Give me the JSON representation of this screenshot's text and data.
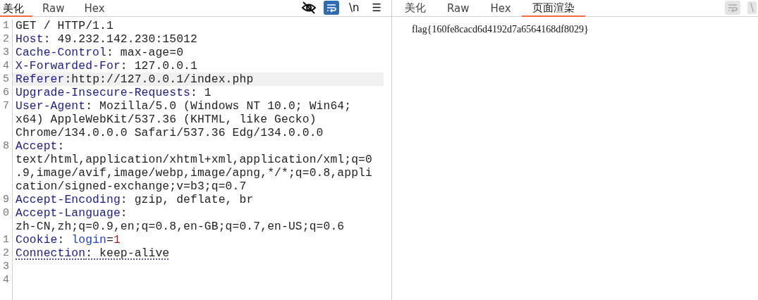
{
  "request_pane": {
    "tabs": [
      {
        "label": "美化",
        "selected": true
      },
      {
        "label": "Raw",
        "selected": false
      },
      {
        "label": "Hex",
        "selected": false
      }
    ],
    "toolbar": {
      "wrap_on": true,
      "newline_label": "\\n",
      "menu_label": "☰"
    },
    "lines": [
      {
        "number": "1",
        "highlighted": false,
        "underlined": false,
        "rows": [
          [
            {
              "kind": "plain",
              "text": "GET / HTTP/1.1"
            }
          ]
        ]
      },
      {
        "number": "2",
        "highlighted": false,
        "underlined": false,
        "rows": [
          [
            {
              "kind": "key",
              "text": "Host"
            },
            {
              "kind": "plain",
              "text": ": 49.232.142.230:15012"
            }
          ]
        ]
      },
      {
        "number": "3",
        "highlighted": false,
        "underlined": false,
        "rows": [
          [
            {
              "kind": "key",
              "text": "Cache-Control"
            },
            {
              "kind": "plain",
              "text": ": max-age=0"
            }
          ]
        ]
      },
      {
        "number": "4",
        "highlighted": false,
        "underlined": false,
        "rows": [
          [
            {
              "kind": "key",
              "text": "X-Forwarded-For"
            },
            {
              "kind": "plain",
              "text": ": 127.0.0.1"
            }
          ]
        ]
      },
      {
        "number": "5",
        "highlighted": true,
        "underlined": false,
        "rows": [
          [
            {
              "kind": "key",
              "text": "Referer"
            },
            {
              "kind": "plain",
              "text": ":http://127.0.0.1/index.php"
            }
          ]
        ]
      },
      {
        "number": "6",
        "highlighted": false,
        "underlined": false,
        "rows": [
          [
            {
              "kind": "key",
              "text": "Upgrade-Insecure-Requests"
            },
            {
              "kind": "plain",
              "text": ": 1"
            }
          ]
        ]
      },
      {
        "number": "7",
        "highlighted": false,
        "underlined": false,
        "rows": [
          [
            {
              "kind": "key",
              "text": "User-Agent"
            },
            {
              "kind": "plain",
              "text": ": Mozilla/5.0 (Windows NT 10.0; Win64;"
            }
          ],
          [
            {
              "kind": "plain",
              "text": "x64) AppleWebKit/537.36 (KHTML, like Gecko)"
            }
          ],
          [
            {
              "kind": "plain",
              "text": "Chrome/134.0.0.0 Safari/537.36 Edg/134.0.0.0"
            }
          ]
        ]
      },
      {
        "number": "8",
        "highlighted": false,
        "underlined": false,
        "rows": [
          [
            {
              "kind": "key",
              "text": "Accept"
            },
            {
              "kind": "plain",
              "text": ":"
            }
          ],
          [
            {
              "kind": "plain",
              "text": "text/html,application/xhtml+xml,application/xml;q=0"
            }
          ],
          [
            {
              "kind": "plain",
              "text": ".9,image/avif,image/webp,image/apng,*/*;q=0.8,appli"
            }
          ],
          [
            {
              "kind": "plain",
              "text": "cation/signed-exchange;v=b3;q=0.7"
            }
          ]
        ]
      },
      {
        "number": "9",
        "highlighted": false,
        "underlined": false,
        "rows": [
          [
            {
              "kind": "key",
              "text": "Accept-Encoding"
            },
            {
              "kind": "plain",
              "text": ": gzip, deflate, br"
            }
          ]
        ]
      },
      {
        "number": "0",
        "highlighted": false,
        "underlined": false,
        "rows": [
          [
            {
              "kind": "key",
              "text": "Accept-Language"
            },
            {
              "kind": "plain",
              "text": ":"
            }
          ],
          [
            {
              "kind": "plain",
              "text": "zh-CN,zh;q=0.9,en;q=0.8,en-GB;q=0.7,en-US;q=0.6"
            }
          ]
        ]
      },
      {
        "number": "1",
        "highlighted": false,
        "underlined": false,
        "rows": [
          [
            {
              "kind": "key",
              "text": "Cookie"
            },
            {
              "kind": "plain",
              "text": ": "
            },
            {
              "kind": "name",
              "text": "login"
            },
            {
              "kind": "plain",
              "text": "="
            },
            {
              "kind": "number",
              "text": "1"
            }
          ]
        ]
      },
      {
        "number": "2",
        "highlighted": false,
        "underlined": true,
        "rows": [
          [
            {
              "kind": "key",
              "text": "Connection"
            },
            {
              "kind": "plain",
              "text": ": keep-alive"
            }
          ]
        ]
      },
      {
        "number": "3",
        "highlighted": false
      },
      {
        "number": "4",
        "highlighted": false
      }
    ]
  },
  "response_pane": {
    "tabs": [
      {
        "label": "美化",
        "selected": false
      },
      {
        "label": "Raw",
        "selected": false
      },
      {
        "label": "Hex",
        "selected": false
      },
      {
        "label": "页面渲染",
        "selected": true
      }
    ],
    "newline_label": "\\",
    "rendered_text": "flag{160fe8cacd6d4192d7a6564168df8029}"
  }
}
